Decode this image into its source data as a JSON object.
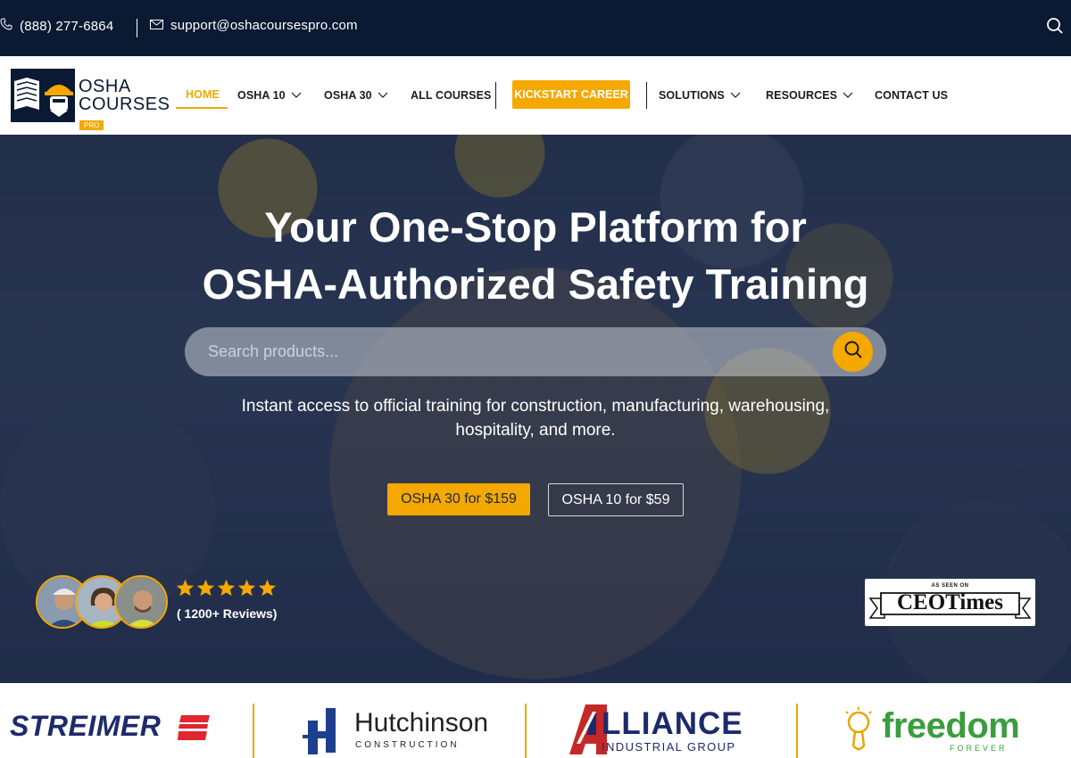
{
  "topbar": {
    "phone": "(888) 277-6864",
    "email": "support@oshacoursespro.com",
    "icons": [
      "phone-icon",
      "mail-icon",
      "search-icon"
    ]
  },
  "brand": {
    "line1": "OSHA",
    "line2": "COURSES",
    "badge": "PRO"
  },
  "nav": {
    "home": "HOME",
    "osha10": "OSHA 10",
    "osha30": "OSHA 30",
    "all_courses": "ALL COURSES",
    "kickstart": "KICKSTART CAREER",
    "solutions": "SOLUTIONS",
    "resources": "RESOURCES",
    "contact": "CONTACT US"
  },
  "hero": {
    "title_line1": "Your One-Stop Platform for",
    "title_line2": "OSHA-Authorized Safety Training",
    "search_placeholder": "Search products...",
    "subtitle": "Instant access to official training for construction, manufacturing, warehousing, hospitality, and more.",
    "cta_primary": "OSHA 30 for $159",
    "cta_secondary": "OSHA 10 for $59",
    "rating_stars": 5,
    "reviews": "( 1200+ Reviews)",
    "press_small": "AS SEEN ON",
    "press_name": "CEOTimes"
  },
  "partners": {
    "streimer": "STREIMER",
    "hutchinson": "Hutchinson",
    "hutchinson_sub": "CONSTRUCTION",
    "alliance": "LLIANCE",
    "alliance_sub": "INDUSTRIAL GROUP",
    "freedom": "freedom",
    "freedom_sub": "FOREVER"
  },
  "colors": {
    "navy": "#0b1a33",
    "accent": "#f5a800",
    "partner_blue": "#1d2a6c",
    "partner_green": "#3a9d3f"
  }
}
